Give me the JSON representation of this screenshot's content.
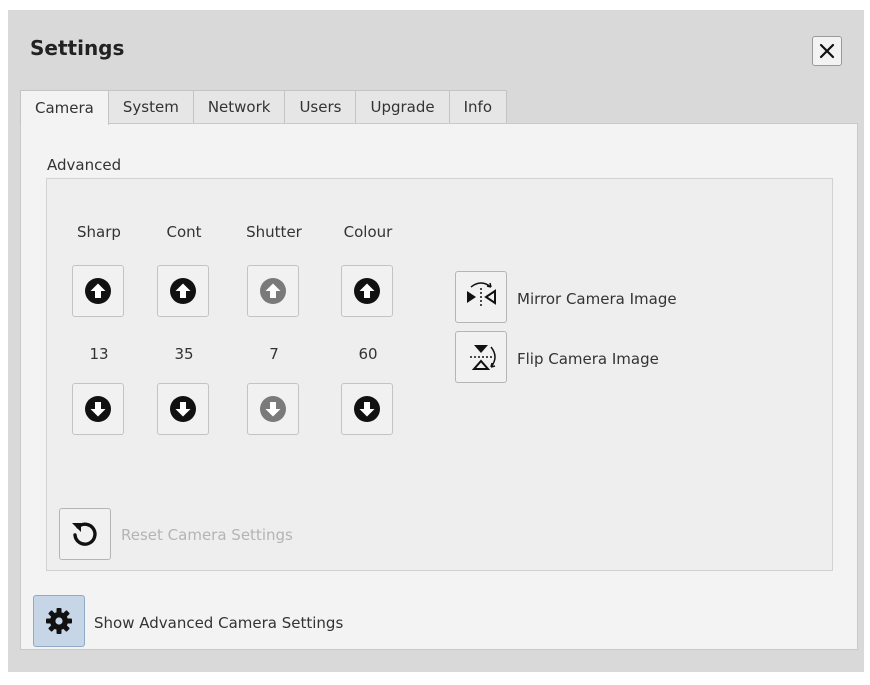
{
  "dialog": {
    "title": "Settings",
    "close_icon": "close-icon"
  },
  "tabs": [
    {
      "label": "Camera",
      "active": true
    },
    {
      "label": "System",
      "active": false
    },
    {
      "label": "Network",
      "active": false
    },
    {
      "label": "Users",
      "active": false
    },
    {
      "label": "Upgrade",
      "active": false
    },
    {
      "label": "Info",
      "active": false
    }
  ],
  "camera": {
    "section_label": "Advanced",
    "controls": [
      {
        "label": "Sharp",
        "value": "13",
        "enabled": true
      },
      {
        "label": "Cont",
        "value": "35",
        "enabled": true
      },
      {
        "label": "Shutter",
        "value": "7",
        "enabled": false
      },
      {
        "label": "Colour",
        "value": "60",
        "enabled": true
      }
    ],
    "mirror_label": "Mirror Camera Image",
    "flip_label": "Flip Camera Image",
    "reset_label": "Reset Camera Settings",
    "advanced_toggle_label": "Show Advanced Camera Settings"
  },
  "colors": {
    "arrow_enabled": "#111111",
    "arrow_disabled": "#7a7a7a",
    "toggle_active_bg": "#c6d6e6"
  }
}
